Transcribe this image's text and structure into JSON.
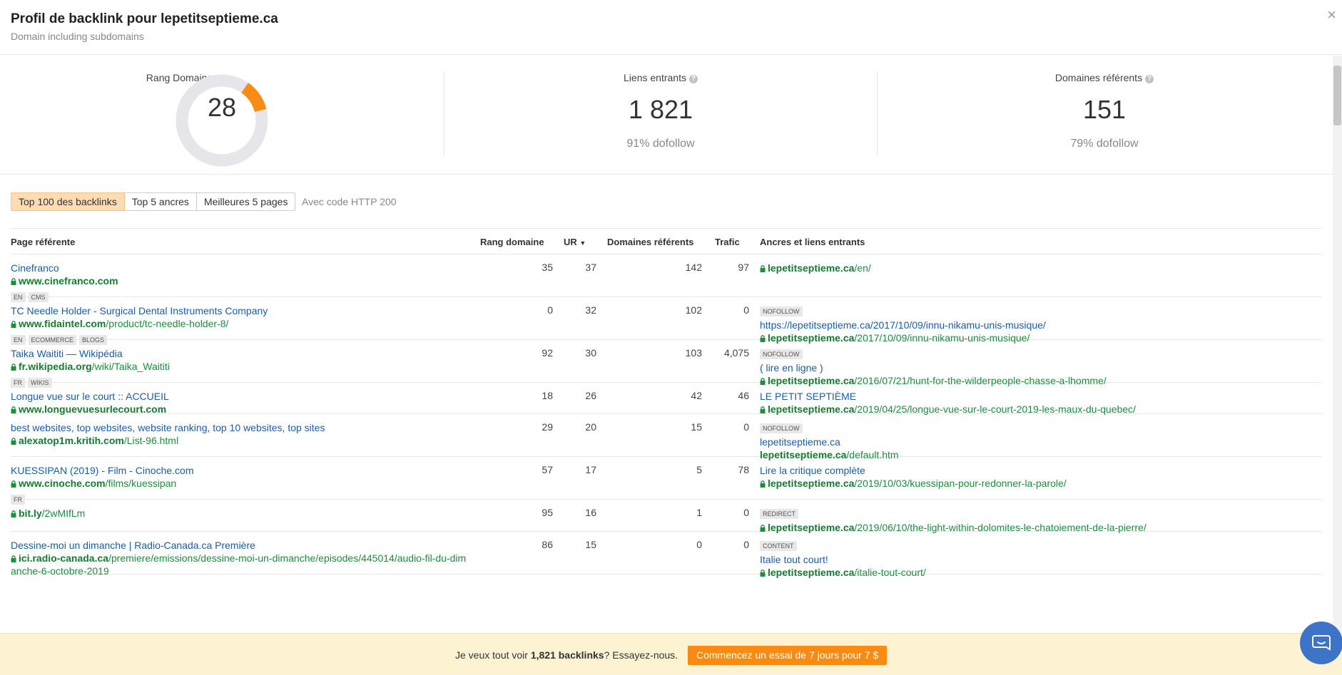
{
  "header": {
    "title": "Profil de backlink pour lepetitseptieme.ca",
    "subtitle": "Domain including subdomains",
    "close_icon": "×"
  },
  "stats": {
    "rank": {
      "label": "Rang Domaine",
      "value": "28",
      "gauge_fraction": 0.28,
      "gauge_color": "#f78b14"
    },
    "backlinks": {
      "label": "Liens entrants",
      "value": "1 821",
      "sub": "91% dofollow"
    },
    "ref_domains": {
      "label": "Domaines référents",
      "value": "151",
      "sub": "79% dofollow"
    }
  },
  "tabs": {
    "items": [
      "Top 100 des backlinks",
      "Top 5 ancres",
      "Meilleures 5 pages"
    ],
    "active": 0,
    "note": "Avec code HTTP 200"
  },
  "table": {
    "columns": {
      "page": "Page référente",
      "dr": "Rang domaine",
      "ur": "UR",
      "domains": "Domaines référents",
      "traffic": "Trafic",
      "anchors": "Ancres et liens entrants"
    },
    "rows": [
      {
        "title": "Cinefranco",
        "url_domain": "www.cinefranco.com",
        "url_path": "",
        "tags": [
          "EN",
          "CMS"
        ],
        "dr": "35",
        "ur": "37",
        "domains": "142",
        "traffic": "97",
        "anchor_tag": "",
        "anchor_text": "",
        "target_domain": "lepetitseptieme.ca",
        "target_path": "/en/",
        "target_lock": true
      },
      {
        "title": "TC Needle Holder - Surgical Dental Instruments Company",
        "url_domain": "www.fidaintel.com",
        "url_path": "/product/tc-needle-holder-8/",
        "tags": [
          "EN",
          "ECOMMERCE",
          "BLOGS"
        ],
        "dr": "0",
        "ur": "32",
        "domains": "102",
        "traffic": "0",
        "anchor_tag": "NOFOLLOW",
        "anchor_text": "https://lepetitseptieme.ca/2017/10/09/innu-nikamu-unis-musique/",
        "target_domain": "lepetitseptieme.ca",
        "target_path": "/2017/10/09/innu-nikamu-unis-musique/",
        "target_lock": true
      },
      {
        "title": "Taika Waititi — Wikipédia",
        "url_domain": "fr.wikipedia.org",
        "url_path": "/wiki/Taika_Waititi",
        "tags": [
          "FR",
          "WIKIS"
        ],
        "dr": "92",
        "ur": "30",
        "domains": "103",
        "traffic": "4,075",
        "anchor_tag": "NOFOLLOW",
        "anchor_text": "( lire en ligne )",
        "target_domain": "lepetitseptieme.ca",
        "target_path": "/2016/07/21/hunt-for-the-wilderpeople-chasse-a-lhomme/",
        "target_lock": true
      },
      {
        "title": "Longue vue sur le court :: ACCUEIL",
        "url_domain": "www.longuevuesurlecourt.com",
        "url_path": "",
        "tags": [],
        "dr": "18",
        "ur": "26",
        "domains": "42",
        "traffic": "46",
        "anchor_tag": "",
        "anchor_text": "LE PETIT SEPTIÈME",
        "target_domain": "lepetitseptieme.ca",
        "target_path": "/2019/04/25/longue-vue-sur-le-court-2019-les-maux-du-quebec/",
        "target_lock": true
      },
      {
        "title": "best websites, top websites, website ranking, top 10 websites, top sites",
        "url_domain": "alexatop1m.kritih.com",
        "url_path": "/List-96.html",
        "tags": [],
        "dr": "29",
        "ur": "20",
        "domains": "15",
        "traffic": "0",
        "anchor_tag": "NOFOLLOW",
        "anchor_text": "lepetitseptieme.ca",
        "target_domain": "lepetitseptieme.ca",
        "target_path": "/default.htm",
        "target_lock": false
      },
      {
        "title": "KUESSIPAN (2019) - Film - Cinoche.com",
        "url_domain": "www.cinoche.com",
        "url_path": "/films/kuessipan",
        "tags": [
          "FR"
        ],
        "dr": "57",
        "ur": "17",
        "domains": "5",
        "traffic": "78",
        "anchor_tag": "",
        "anchor_text": "Lire la critique complète",
        "target_domain": "lepetitseptieme.ca",
        "target_path": "/2019/10/03/kuessipan-pour-redonner-la-parole/",
        "target_lock": true
      },
      {
        "title": "",
        "url_domain": "bit.ly",
        "url_path": "/2wMIfLm",
        "tags": [],
        "dr": "95",
        "ur": "16",
        "domains": "1",
        "traffic": "0",
        "anchor_tag": "REDIRECT",
        "anchor_text": "",
        "target_domain": "lepetitseptieme.ca",
        "target_path": "/2019/06/10/the-light-within-dolomites-le-chatoiement-de-la-pierre/",
        "target_lock": true
      },
      {
        "title": "Dessine-moi un dimanche | Radio-Canada.ca Première",
        "url_domain": "ici.radio-canada.ca",
        "url_path": "/premiere/emissions/dessine-moi-un-dimanche/episodes/445014/audio-fil-du-dimanche-6-octobre-2019",
        "tags": [],
        "dr": "86",
        "ur": "15",
        "domains": "0",
        "traffic": "0",
        "anchor_tag": "CONTENT",
        "anchor_text": "Italie tout court!",
        "target_domain": "lepetitseptieme.ca",
        "target_path": "/italie-tout-court/",
        "target_lock": true
      }
    ]
  },
  "footer": {
    "text_before": "Je veux tout voir ",
    "text_bold": "1,821 backlinks",
    "text_after": "? Essayez-nous.",
    "cta_label": "Commencez un essai de 7 jours pour 7 $"
  }
}
